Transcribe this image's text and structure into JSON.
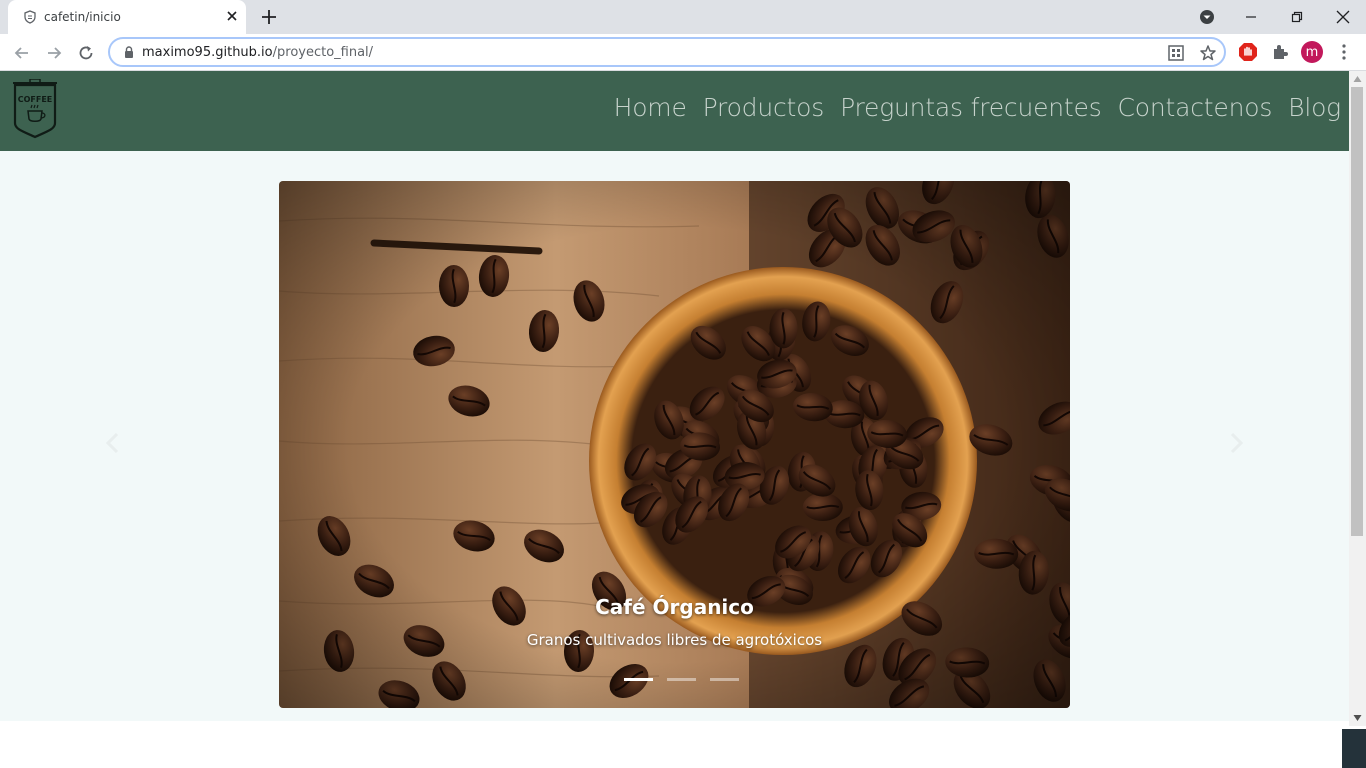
{
  "browser": {
    "tab_title": "cafetin/inicio",
    "url_host": "maximo95.github.io",
    "url_path": "/proyecto_final/",
    "profile_initial": "m"
  },
  "site": {
    "logo_text": "COFFEE",
    "nav": [
      "Home",
      "Productos",
      "Preguntas frecuentes",
      "Contactenos",
      "Blog"
    ],
    "nav_color": "#c7d3cc",
    "header_color": "#3d6250"
  },
  "carousel": {
    "caption_title": "Café Órganico",
    "caption_text": "Granos cultivados libres de agrotóxicos",
    "slide_count": 3,
    "active_slide": 1
  }
}
